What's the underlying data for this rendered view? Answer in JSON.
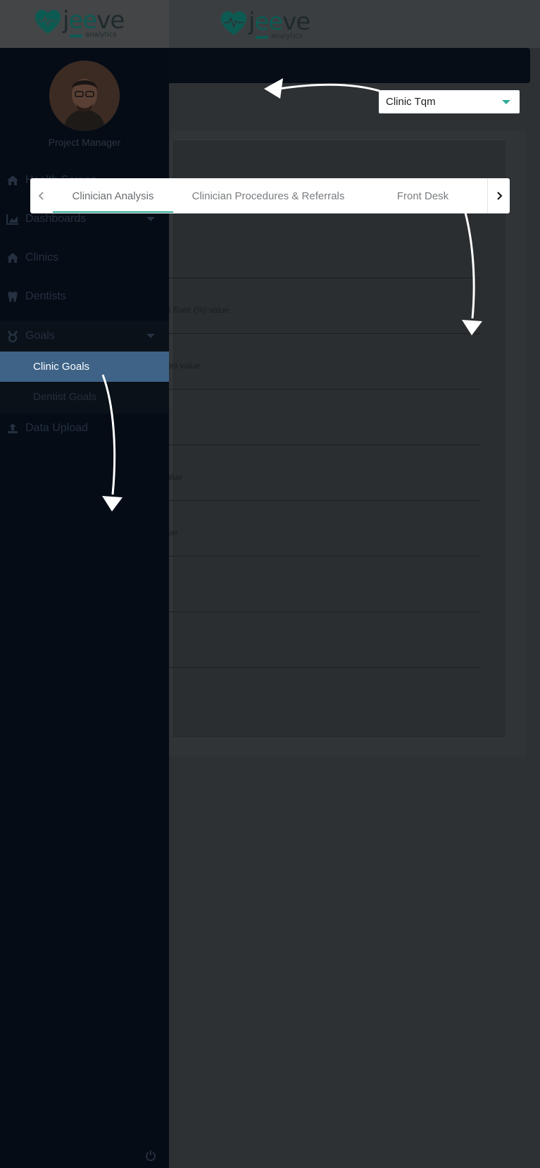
{
  "logo": {
    "name_part1": "j",
    "name_part2": "ee",
    "name_part3": "ve",
    "tagline": "analytics"
  },
  "sidebar": {
    "role": "Project Manager",
    "items": [
      {
        "label": "Health Screen",
        "icon": "home-icon"
      },
      {
        "label": "Dashboards",
        "icon": "chart-icon"
      },
      {
        "label": "Clinics",
        "icon": "home-icon"
      },
      {
        "label": "Dentists",
        "icon": "tooth-icon"
      },
      {
        "label": "Goals",
        "icon": "medal-icon"
      },
      {
        "label": "Data Upload",
        "icon": "upload-icon"
      }
    ],
    "goals_children": [
      {
        "label": "Clinic Goals"
      },
      {
        "label": "Dentist Goals"
      }
    ]
  },
  "clinic_select": {
    "value": "Clinic Tqm"
  },
  "tabs": [
    {
      "label": "Clinician Analysis"
    },
    {
      "label": "Clinician Procedures & Referrals"
    },
    {
      "label": "Front Desk"
    }
  ],
  "rows": [
    {
      "label": ""
    },
    {
      "label": "n Rate (%) value"
    },
    {
      "label": "ost value"
    },
    {
      "label": ""
    },
    {
      "label": "alue"
    },
    {
      "label": "lue"
    },
    {
      "label": ""
    },
    {
      "label": ""
    }
  ],
  "colors": {
    "accent": "#2eab97",
    "sidebar": "#050c16",
    "active_item": "#3e6387"
  }
}
